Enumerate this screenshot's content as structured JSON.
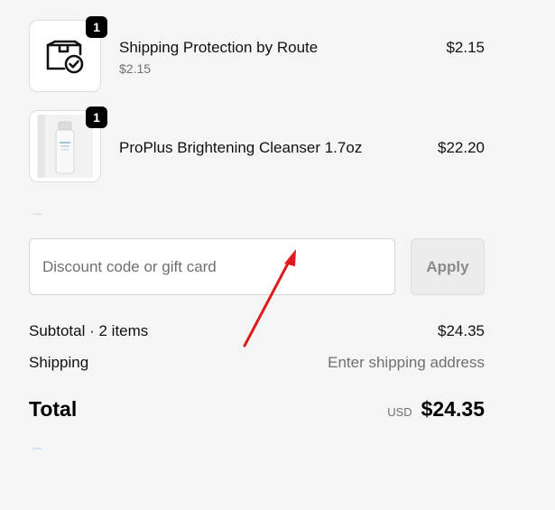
{
  "items": [
    {
      "title": "Shipping Protection by Route",
      "subprice": "$2.15",
      "price": "$2.15",
      "quantity": "1",
      "icon": "package-check-icon"
    },
    {
      "title": "ProPlus Brightening Cleanser 1.7oz",
      "price": "$22.20",
      "quantity": "1",
      "icon": "cleanser-bottle-image"
    }
  ],
  "discount": {
    "placeholder": "Discount code or gift card",
    "value": "",
    "apply_label": "Apply"
  },
  "summary": {
    "subtotal_label": "Subtotal · 2 items",
    "subtotal_value": "$24.35",
    "shipping_label": "Shipping",
    "shipping_value": "Enter shipping address",
    "total_label": "Total",
    "currency": "USD",
    "total_value": "$24.35"
  },
  "colors": {
    "background": "#f5f5f5",
    "annotation_arrow": "#e01b1b",
    "badge": "#000000"
  }
}
